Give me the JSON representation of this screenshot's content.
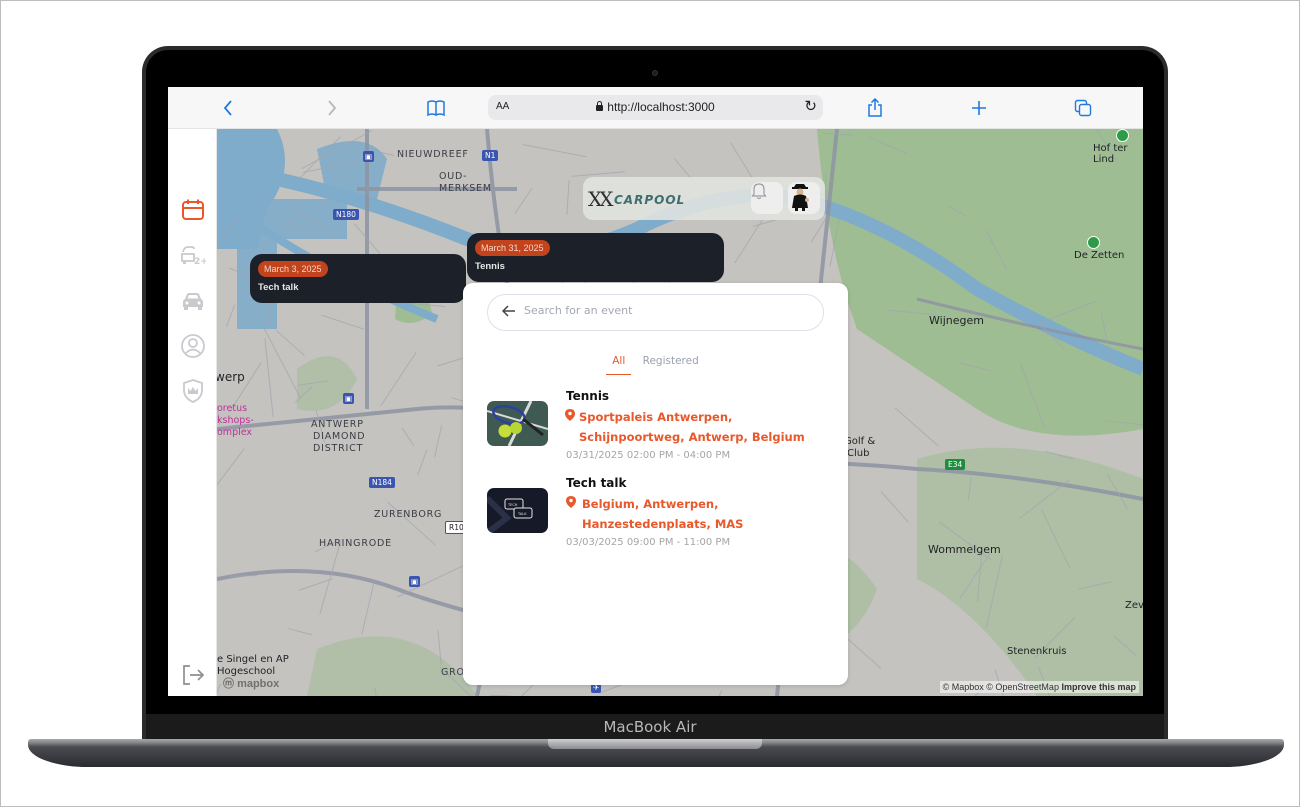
{
  "device": {
    "label": "MacBook Air"
  },
  "browser": {
    "url": "http://localhost:3000",
    "text_size_label": "AA",
    "icons": [
      "back-icon",
      "forward-icon",
      "bookmarks-icon",
      "lock-icon",
      "reload-icon",
      "share-icon",
      "new-tab-icon",
      "tabs-icon"
    ]
  },
  "sidebar": {
    "items": [
      {
        "name": "events",
        "icon": "calendar-icon",
        "active": true
      },
      {
        "name": "carpool-2plus",
        "icon": "car-2plus-icon",
        "active": false
      },
      {
        "name": "my-car",
        "icon": "car-icon",
        "active": false
      },
      {
        "name": "profile",
        "icon": "user-circle-icon",
        "active": false
      },
      {
        "name": "admin",
        "icon": "shield-crown-icon",
        "active": false
      }
    ],
    "logout_icon": "logout-icon"
  },
  "header": {
    "logo_mark": "XX",
    "logo_text": "CARPOOL",
    "notification_icon": "bell-icon",
    "avatar_icon": "avatar-icon"
  },
  "tooltips": [
    {
      "date": "March 31, 2025",
      "title": "Tennis"
    },
    {
      "date": "March 3, 2025",
      "title": "Tech talk"
    }
  ],
  "panel": {
    "search": {
      "placeholder": "Search for an event",
      "value": ""
    },
    "tabs": [
      {
        "label": "All",
        "active": true
      },
      {
        "label": "Registered",
        "active": false
      }
    ],
    "events": [
      {
        "title": "Tennis",
        "location_line1": "Sportpaleis Antwerpen,",
        "location_line2": "Schijnpoortweg, Antwerp, Belgium",
        "time": "03/31/2025 02:00 PM - 04:00 PM",
        "thumbnail": "tennis-image"
      },
      {
        "title": "Tech talk",
        "location_line1": "Belgium, Antwerpen,",
        "location_line2": "Hanzestedenplaats, MAS",
        "time": "03/03/2025 09:00 PM - 11:00 PM",
        "thumbnail": "tech-talk-image"
      }
    ]
  },
  "map": {
    "labels": {
      "nieuwdreef": "NIEUWDREEF",
      "oud_merksem_1": "OUD-",
      "oud_merksem_2": "MERKSEM",
      "antwerp": "werp",
      "diamond_1": "ANTWERP",
      "diamond_2": "DIAMOND",
      "diamond_3": "DISTRICT",
      "zurenborg": "ZURENBORG",
      "haringrode": "HARINGRODE",
      "plantin_1": "oretus",
      "plantin_2": "kshops-",
      "plantin_3": "omplex",
      "singel_1": "e Singel en AP",
      "singel_2": "Hogeschool",
      "groen": "GROE",
      "wijnegem": "Wijnegem",
      "wommelgem": "Wommelgem",
      "stenenkruis": "Stenenkruis",
      "golf_1": "Golf &",
      "golf_2": "Club",
      "hof_ter_linde": "Hof ter Lind",
      "de_zetten": "De Zetten",
      "zeve": "Zeve"
    },
    "shields": {
      "n1": "N1",
      "n180": "N180",
      "n184": "N184",
      "r10": "R10",
      "e34": "E34"
    },
    "attribution": "© Mapbox © OpenStreetMap",
    "improve_link": "Improve this map",
    "logo": "mapbox"
  },
  "colors": {
    "accent": "#e8582a",
    "tooltip_bg": "#1b2029",
    "tooltip_badge": "#c2431c",
    "browser_blue": "#1f7ae0"
  }
}
